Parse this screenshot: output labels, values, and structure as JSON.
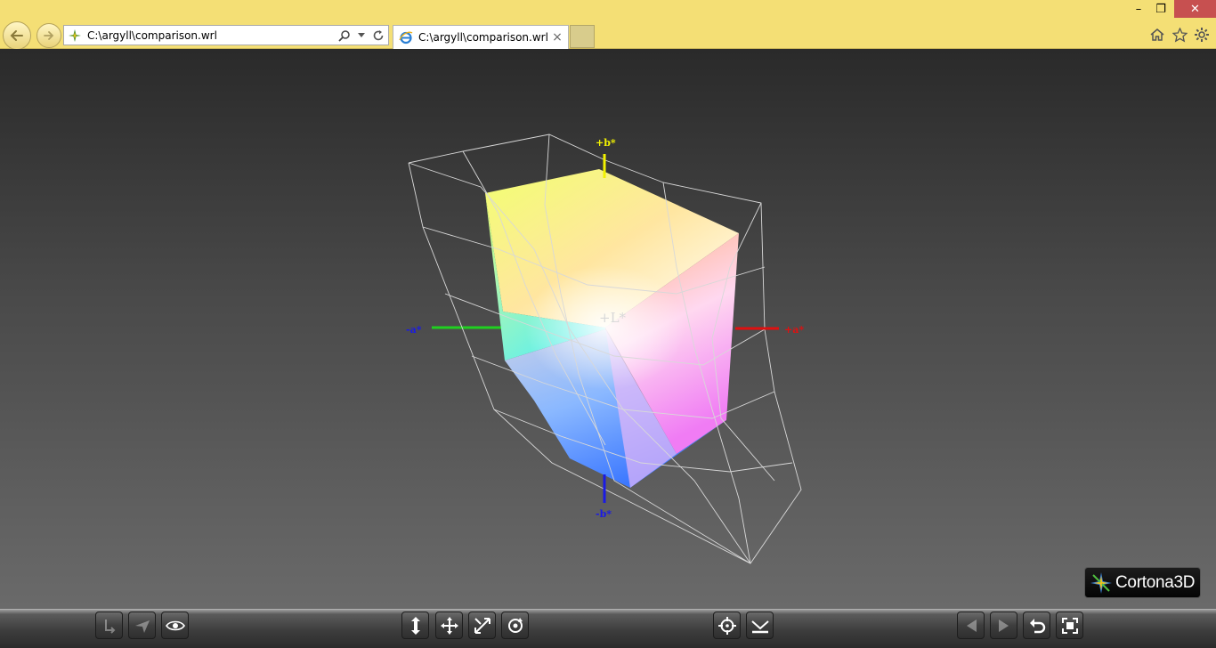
{
  "browser": {
    "address": "C:\\argyll\\comparison.wrl",
    "tab_title": "C:\\argyll\\comparison.wrl",
    "tab_close": "×",
    "window_controls": {
      "minimize": "–",
      "restore": "❐",
      "close": "✕"
    }
  },
  "scene": {
    "axis_labels": {
      "plus_b": "+b*",
      "minus_b": "-b*",
      "plus_a": "+a*",
      "minus_a": "-a*",
      "plus_L": "+L*"
    },
    "colors": {
      "plus_b_axis": "#f2f200",
      "minus_b_axis": "#1a1ae6",
      "plus_a_axis": "#e01010",
      "minus_a_axis": "#20d020",
      "wireframe": "#d8d8d8"
    }
  },
  "logo": {
    "text": "Cortona3D"
  },
  "toolbar": {
    "left_group": [
      "straighten-icon",
      "plane-icon",
      "eye-icon"
    ],
    "middle_group": [
      "walk-icon",
      "pan-icon",
      "study-icon",
      "rotate-icon"
    ],
    "center_group": [
      "goto-icon",
      "align-icon"
    ],
    "right_group": [
      "previous-viewpoint-icon",
      "next-viewpoint-icon",
      "restore-icon",
      "fit-icon"
    ]
  }
}
